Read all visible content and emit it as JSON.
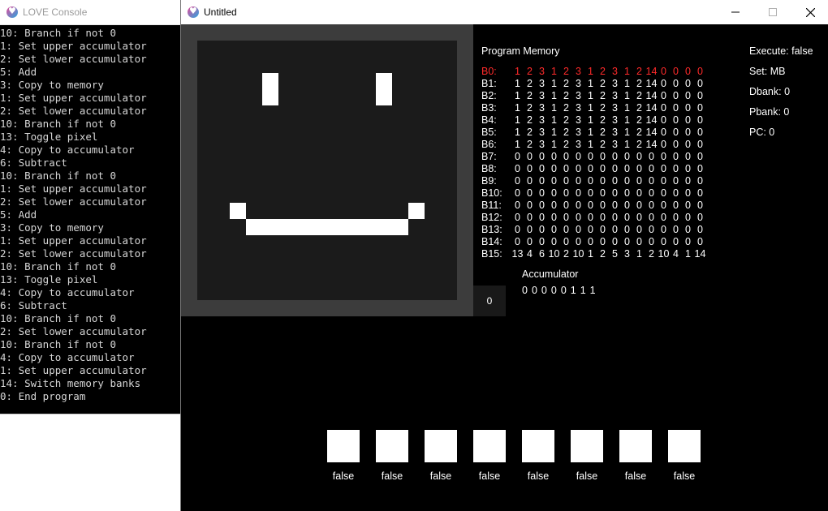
{
  "console": {
    "title": "LOVE Console",
    "lines": [
      "10: Branch if not 0",
      "1: Set upper accumulator",
      "2: Set lower accumulator",
      "5: Add",
      "3: Copy to memory",
      "1: Set upper accumulator",
      "2: Set lower accumulator",
      "10: Branch if not 0",
      "13: Toggle pixel",
      "4: Copy to accumulator",
      "6: Subtract",
      "10: Branch if not 0",
      "1: Set upper accumulator",
      "2: Set lower accumulator",
      "5: Add",
      "3: Copy to memory",
      "1: Set upper accumulator",
      "2: Set lower accumulator",
      "10: Branch if not 0",
      "13: Toggle pixel",
      "4: Copy to accumulator",
      "6: Subtract",
      "10: Branch if not 0",
      "2: Set lower accumulator",
      "10: Branch if not 0",
      "4: Copy to accumulator",
      "1: Set upper accumulator",
      "14: Switch memory banks",
      "0: End program"
    ]
  },
  "window": {
    "title": "Untitled",
    "minimize": "—",
    "maximize": "☐",
    "close": "✕"
  },
  "display_pixels": [
    {
      "col": 4,
      "row": 2
    },
    {
      "col": 4,
      "row": 3
    },
    {
      "col": 11,
      "row": 2
    },
    {
      "col": 11,
      "row": 3
    },
    {
      "col": 2,
      "row": 10
    },
    {
      "col": 13,
      "row": 10
    },
    {
      "col": 3,
      "row": 11
    },
    {
      "col": 4,
      "row": 11
    },
    {
      "col": 5,
      "row": 11
    },
    {
      "col": 6,
      "row": 11
    },
    {
      "col": 7,
      "row": 11
    },
    {
      "col": 8,
      "row": 11
    },
    {
      "col": 9,
      "row": 11
    },
    {
      "col": 10,
      "row": 11
    },
    {
      "col": 11,
      "row": 11
    },
    {
      "col": 12,
      "row": 11
    }
  ],
  "program_memory": {
    "title": "Program Memory",
    "active_row": 0,
    "rows": [
      {
        "label": "B0:",
        "values": [
          "1",
          "2",
          "3",
          "1",
          "2",
          "3",
          "1",
          "2",
          "3",
          "1",
          "2",
          "14",
          "0",
          "0",
          "0",
          "0"
        ]
      },
      {
        "label": "B1:",
        "values": [
          "1",
          "2",
          "3",
          "1",
          "2",
          "3",
          "1",
          "2",
          "3",
          "1",
          "2",
          "14",
          "0",
          "0",
          "0",
          "0"
        ]
      },
      {
        "label": "B2:",
        "values": [
          "1",
          "2",
          "3",
          "1",
          "2",
          "3",
          "1",
          "2",
          "3",
          "1",
          "2",
          "14",
          "0",
          "0",
          "0",
          "0"
        ]
      },
      {
        "label": "B3:",
        "values": [
          "1",
          "2",
          "3",
          "1",
          "2",
          "3",
          "1",
          "2",
          "3",
          "1",
          "2",
          "14",
          "0",
          "0",
          "0",
          "0"
        ]
      },
      {
        "label": "B4:",
        "values": [
          "1",
          "2",
          "3",
          "1",
          "2",
          "3",
          "1",
          "2",
          "3",
          "1",
          "2",
          "14",
          "0",
          "0",
          "0",
          "0"
        ]
      },
      {
        "label": "B5:",
        "values": [
          "1",
          "2",
          "3",
          "1",
          "2",
          "3",
          "1",
          "2",
          "3",
          "1",
          "2",
          "14",
          "0",
          "0",
          "0",
          "0"
        ]
      },
      {
        "label": "B6:",
        "values": [
          "1",
          "2",
          "3",
          "1",
          "2",
          "3",
          "1",
          "2",
          "3",
          "1",
          "2",
          "14",
          "0",
          "0",
          "0",
          "0"
        ]
      },
      {
        "label": "B7:",
        "values": [
          "0",
          "0",
          "0",
          "0",
          "0",
          "0",
          "0",
          "0",
          "0",
          "0",
          "0",
          "0",
          "0",
          "0",
          "0",
          "0"
        ]
      },
      {
        "label": "B8:",
        "values": [
          "0",
          "0",
          "0",
          "0",
          "0",
          "0",
          "0",
          "0",
          "0",
          "0",
          "0",
          "0",
          "0",
          "0",
          "0",
          "0"
        ]
      },
      {
        "label": "B9:",
        "values": [
          "0",
          "0",
          "0",
          "0",
          "0",
          "0",
          "0",
          "0",
          "0",
          "0",
          "0",
          "0",
          "0",
          "0",
          "0",
          "0"
        ]
      },
      {
        "label": "B10:",
        "values": [
          "0",
          "0",
          "0",
          "0",
          "0",
          "0",
          "0",
          "0",
          "0",
          "0",
          "0",
          "0",
          "0",
          "0",
          "0",
          "0"
        ]
      },
      {
        "label": "B11:",
        "values": [
          "0",
          "0",
          "0",
          "0",
          "0",
          "0",
          "0",
          "0",
          "0",
          "0",
          "0",
          "0",
          "0",
          "0",
          "0",
          "0"
        ]
      },
      {
        "label": "B12:",
        "values": [
          "0",
          "0",
          "0",
          "0",
          "0",
          "0",
          "0",
          "0",
          "0",
          "0",
          "0",
          "0",
          "0",
          "0",
          "0",
          "0"
        ]
      },
      {
        "label": "B13:",
        "values": [
          "0",
          "0",
          "0",
          "0",
          "0",
          "0",
          "0",
          "0",
          "0",
          "0",
          "0",
          "0",
          "0",
          "0",
          "0",
          "0"
        ]
      },
      {
        "label": "B14:",
        "values": [
          "0",
          "0",
          "0",
          "0",
          "0",
          "0",
          "0",
          "0",
          "0",
          "0",
          "0",
          "0",
          "0",
          "0",
          "0",
          "0"
        ]
      },
      {
        "label": "B15:",
        "values": [
          "13",
          "4",
          "6",
          "10",
          "2",
          "10",
          "1",
          "2",
          "5",
          "3",
          "1",
          "2",
          "10",
          "4",
          "1",
          "14"
        ]
      }
    ]
  },
  "status": {
    "execute": "Execute: false",
    "set": "Set: MB",
    "dbank": "Dbank: 0",
    "pbank": "Pbank: 0",
    "pc": "PC: 0"
  },
  "zero_value": "0",
  "accumulator": {
    "title": "Accumulator",
    "bits": [
      "0",
      "0",
      "0",
      "0",
      "0",
      "1",
      "1",
      "1"
    ]
  },
  "io_labels": [
    "false",
    "false",
    "false",
    "false",
    "false",
    "false",
    "false",
    "false"
  ],
  "colors": {
    "active_row": "#ff2a2a",
    "screen_bg": "#1b1b1b",
    "frame": "#3c3c3c",
    "pixel_on": "#ffffff"
  }
}
